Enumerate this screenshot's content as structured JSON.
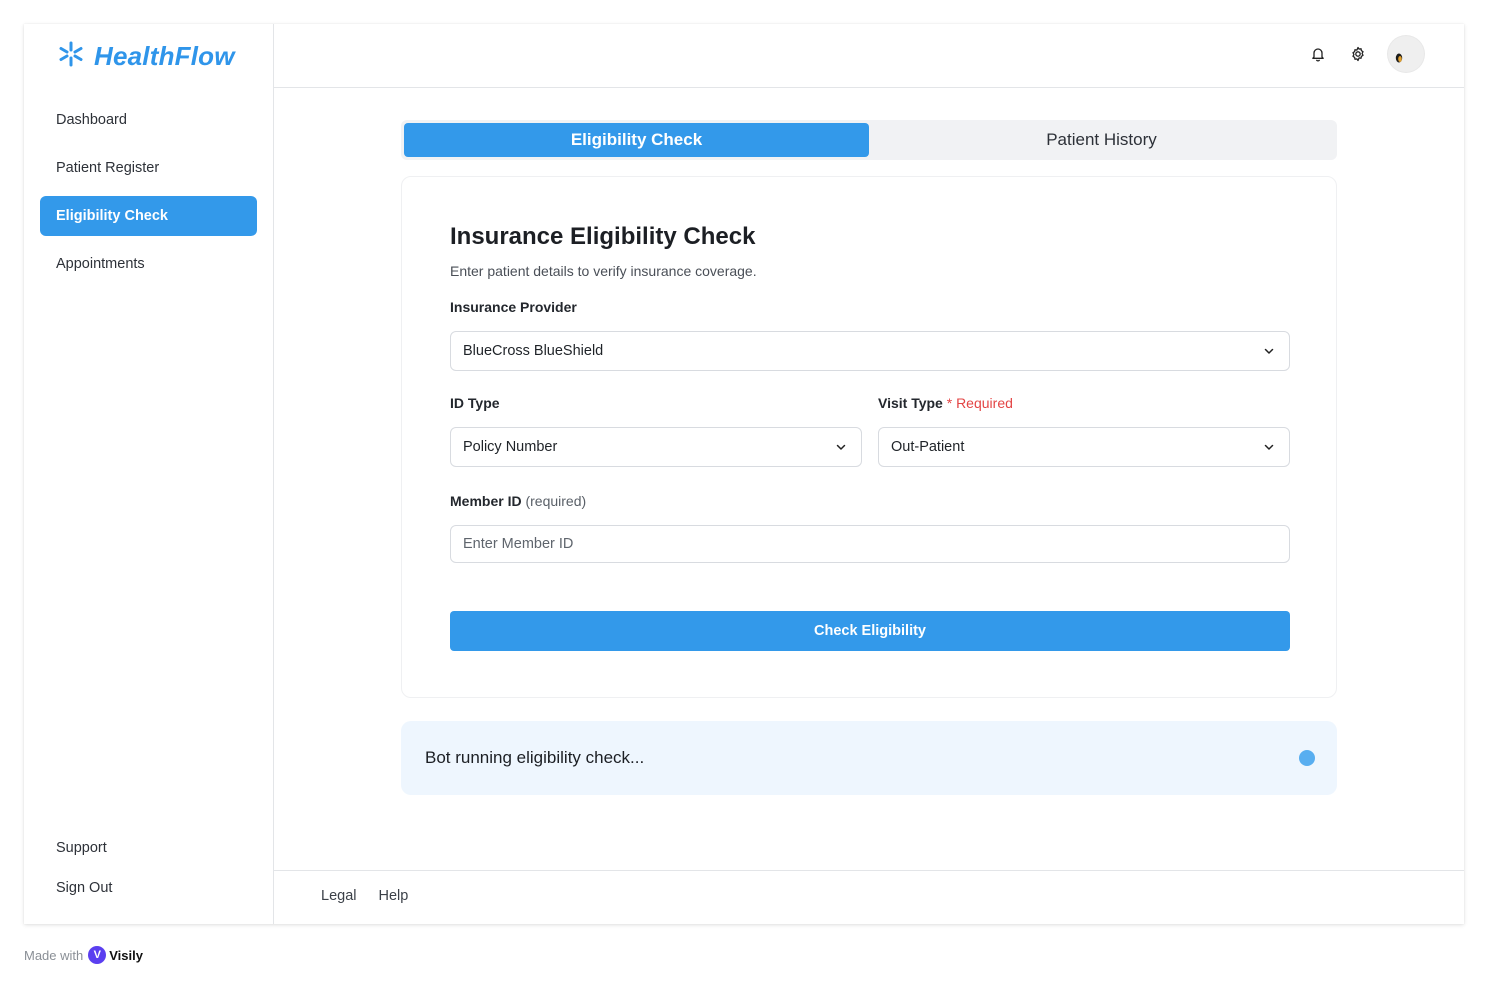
{
  "app": {
    "brand": "HealthFlow",
    "brand_icon": "asterisk-logo-icon",
    "accent": "#3399ea"
  },
  "sidebar": {
    "items": [
      {
        "label": "Dashboard",
        "active": false
      },
      {
        "label": "Patient Register",
        "active": false
      },
      {
        "label": "Eligibility Check",
        "active": true
      },
      {
        "label": "Appointments",
        "active": false
      }
    ],
    "bottom_items": [
      {
        "label": "Support"
      },
      {
        "label": "Sign Out"
      }
    ]
  },
  "header": {
    "icons": [
      "bell-icon",
      "gear-icon"
    ],
    "avatar": "user-avatar"
  },
  "tabs": [
    {
      "label": "Eligibility Check",
      "active": true
    },
    {
      "label": "Patient History",
      "active": false
    }
  ],
  "form": {
    "title": "Insurance Eligibility Check",
    "subtitle": "Enter patient details to verify insurance coverage.",
    "provider": {
      "label": "Insurance Provider",
      "value": "BlueCross BlueShield"
    },
    "id_type": {
      "label": "ID Type",
      "value": "Policy Number"
    },
    "visit_type": {
      "label": "Visit Type",
      "required_text": "* Required",
      "value": "Out-Patient"
    },
    "member_id": {
      "label": "Member ID",
      "hint": "(required)",
      "placeholder": "Enter Member ID",
      "value": ""
    },
    "submit_label": "Check Eligibility"
  },
  "status": {
    "text": "Bot running eligibility check...",
    "indicator_color": "#58aef0"
  },
  "footer": {
    "links": [
      "Legal",
      "Help"
    ]
  },
  "watermark": {
    "prefix": "Made with",
    "brand": "Visily"
  }
}
